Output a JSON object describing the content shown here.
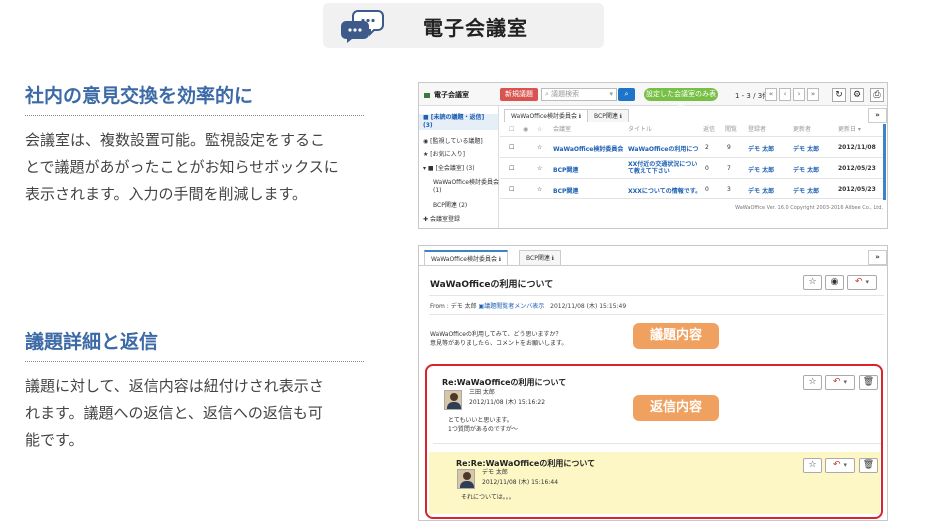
{
  "header": {
    "title": "電子会議室",
    "icon": "chat-bubbles-icon"
  },
  "section1": {
    "heading": "社内の意見交換を効率的に",
    "lines": [
      "会議室は、複数設置可能。監視設定をするこ",
      "とで議題があがったことがお知らせボックスに",
      "表示されます。入力の手間を削減します。"
    ]
  },
  "section2": {
    "heading": "議題詳細と返信",
    "lines": [
      "議題に対して、返信内容は紐付けされ表示さ",
      "れます。議題への返信と、返信への返信も可",
      "能です。"
    ]
  },
  "list_screen": {
    "app_name": "電子会議室",
    "new_button": "新規議題",
    "search_placeholder": "議題検索",
    "filter_button": "設定した会議室のみ表示",
    "pager": "1 - 3 / 3件",
    "sidebar": [
      "[未読の議題・返信]",
      "(3)",
      "[監視している議題]",
      "[お気に入り]",
      "[全会議室] (3)",
      "WaWaOffice検討委員会",
      "(1)",
      "BCP関連 (2)",
      "会議室登録"
    ],
    "tabs": [
      "WaWaOffice検討委員会 ℹ",
      "BCP関連 ℹ"
    ],
    "columns": [
      "会議室",
      "タイトル",
      "返信",
      "閲覧",
      "登録者",
      "更新者",
      "更新日 ▾"
    ],
    "rows": [
      {
        "room": "WaWaOffice検討委員会",
        "title": "WaWaOfficeの利用について",
        "replies": "2",
        "views": "9",
        "creator": "デモ 太郎",
        "updater": "デモ 太郎",
        "date": "2012/11/08"
      },
      {
        "room": "BCP関連",
        "title": "XX付近の交通状況について教えて下さい",
        "replies": "0",
        "views": "7",
        "creator": "デモ 太郎",
        "updater": "デモ 太郎",
        "date": "2012/05/23"
      },
      {
        "room": "BCP関連",
        "title": "XXXについての情報です。",
        "replies": "0",
        "views": "3",
        "creator": "デモ 太郎",
        "updater": "デモ 太郎",
        "date": "2012/05/23"
      }
    ],
    "footer": "WaWaOffice Ver. 16.0 Copyright 2003-2016 Ailbee Co., Ltd."
  },
  "detail_screen": {
    "tabs": [
      "WaWaOffice検討委員会 ℹ",
      "BCP関連 ℹ"
    ],
    "more": "»",
    "title": "WaWaOfficeの利用について",
    "from_label": "From : デモ 太郎",
    "members_link": "議題閲覧者メンバ表示",
    "posted": "2012/11/08 (木) 15:15:49",
    "body_lines": [
      "WaWaOfficeの利用してみて、どう思いますか？",
      "意見等がありましたら、コメントをお願いします。"
    ],
    "badge_topic": "議題内容",
    "badge_reply": "返信内容",
    "reply1": {
      "title": "Re:WaWaOfficeの利用について",
      "author": "三田 太郎",
      "date": "2012/11/08 (木) 15:16:22",
      "body_lines": [
        "とてもいいと思います。",
        "1つ質問があるのですが〜"
      ]
    },
    "reply2": {
      "title": "Re:Re:WaWaOfficeの利用について",
      "author": "デモ 太郎",
      "date": "2012/11/08 (木) 15:16:44",
      "body": "それについては。。。"
    }
  }
}
